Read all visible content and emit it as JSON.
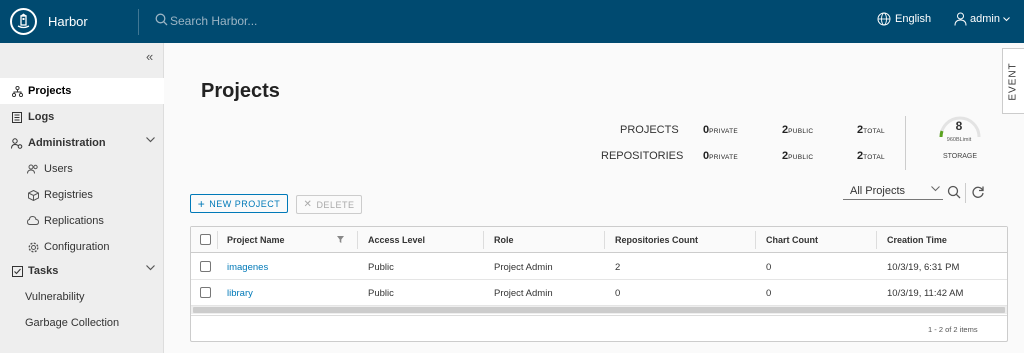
{
  "header": {
    "brand": "Harbor",
    "search_placeholder": "Search Harbor...",
    "language": "English",
    "user": "admin"
  },
  "sidebar": {
    "items": [
      {
        "label": "Projects",
        "icon": "projects-icon"
      },
      {
        "label": "Logs",
        "icon": "logs-icon"
      },
      {
        "label": "Administration",
        "icon": "administration-icon"
      },
      {
        "label": "Users",
        "icon": "users-icon"
      },
      {
        "label": "Registries",
        "icon": "registries-icon"
      },
      {
        "label": "Replications",
        "icon": "replications-icon"
      },
      {
        "label": "Configuration",
        "icon": "configuration-icon"
      },
      {
        "label": "Tasks",
        "icon": "tasks-icon"
      },
      {
        "label": "Vulnerability"
      },
      {
        "label": "Garbage Collection"
      }
    ]
  },
  "main": {
    "title": "Projects",
    "event_tab": "EVENT",
    "stats": {
      "projects_label": "PROJECTS",
      "repositories_label": "REPOSITORIES",
      "projects": {
        "private": "0",
        "public": "2",
        "total": "2"
      },
      "repositories": {
        "private": "0",
        "public": "2",
        "total": "2"
      },
      "private_unit": "PRIVATE",
      "public_unit": "PUBLIC",
      "total_unit": "TOTAL",
      "storage_value": "8",
      "storage_limit": "960BLimit",
      "storage_label": "STORAGE"
    },
    "toolbar": {
      "new_project": "NEW PROJECT",
      "delete": "DELETE",
      "filter_selected": "All Projects"
    },
    "table": {
      "headers": [
        "Project Name",
        "Access Level",
        "Role",
        "Repositories Count",
        "Chart Count",
        "Creation Time"
      ],
      "rows": [
        {
          "name": "imagenes",
          "access": "Public",
          "role": "Project Admin",
          "repos": "2",
          "charts": "0",
          "created": "10/3/19, 6:31 PM"
        },
        {
          "name": "library",
          "access": "Public",
          "role": "Project Admin",
          "repos": "0",
          "charts": "0",
          "created": "10/3/19, 11:42 AM"
        }
      ],
      "footer_count": "1 - 2 of 2 items"
    }
  }
}
